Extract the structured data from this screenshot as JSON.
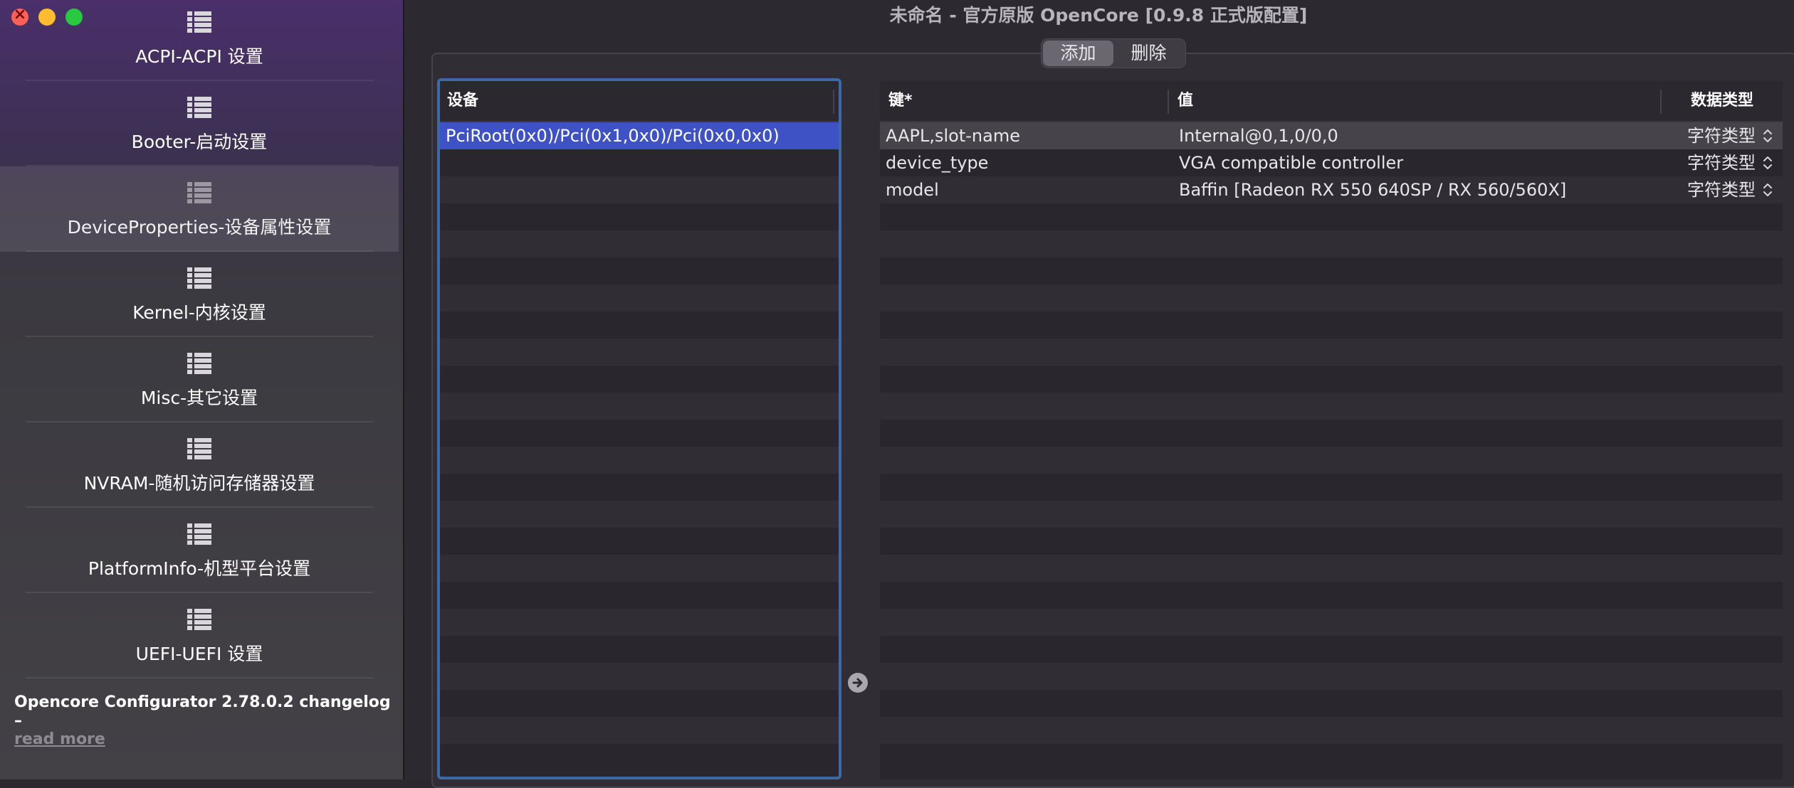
{
  "window": {
    "title": "未命名 - 官方原版 OpenCore [0.9.8 正式版配置]"
  },
  "sidebar": {
    "items": [
      {
        "label": "ACPI-ACPI 设置",
        "icon": "list-icon",
        "active": false
      },
      {
        "label": "Booter-启动设置",
        "icon": "list-icon",
        "active": false
      },
      {
        "label": "DeviceProperties-设备属性设置",
        "icon": "list-icon",
        "active": true
      },
      {
        "label": "Kernel-内核设置",
        "icon": "list-icon",
        "active": false
      },
      {
        "label": "Misc-其它设置",
        "icon": "list-icon",
        "active": false
      },
      {
        "label": "NVRAM-随机访问存储器设置",
        "icon": "list-icon",
        "active": false
      },
      {
        "label": "PlatformInfo-机型平台设置",
        "icon": "list-icon",
        "active": false
      },
      {
        "label": "UEFI-UEFI 设置",
        "icon": "list-icon",
        "active": false
      }
    ],
    "changelog_text": "Opencore Configurator 2.78.0.2 changelog –",
    "read_more": "read more"
  },
  "toolbar": {
    "add_label": "添加",
    "delete_label": "删除"
  },
  "devices": {
    "header": "设备",
    "rows": [
      "PciRoot(0x0)/Pci(0x1,0x0)/Pci(0x0,0x0)"
    ],
    "selected_index": 0
  },
  "properties": {
    "headers": {
      "key": "键*",
      "value": "值",
      "type": "数据类型"
    },
    "rows": [
      {
        "key": "AAPL,slot-name",
        "value": "Internal@0,1,0/0,0",
        "type": "字符类型"
      },
      {
        "key": "device_type",
        "value": "VGA compatible controller",
        "type": "字符类型"
      },
      {
        "key": "model",
        "value": "Baffin [Radeon RX 550 640SP / RX 560/560X]",
        "type": "字符类型"
      }
    ],
    "selected_index": 0
  },
  "colors": {
    "selection_blue": "#3e52c6",
    "focus_border": "#3d6aa6",
    "sidebar_top": "#4a2f6a"
  }
}
